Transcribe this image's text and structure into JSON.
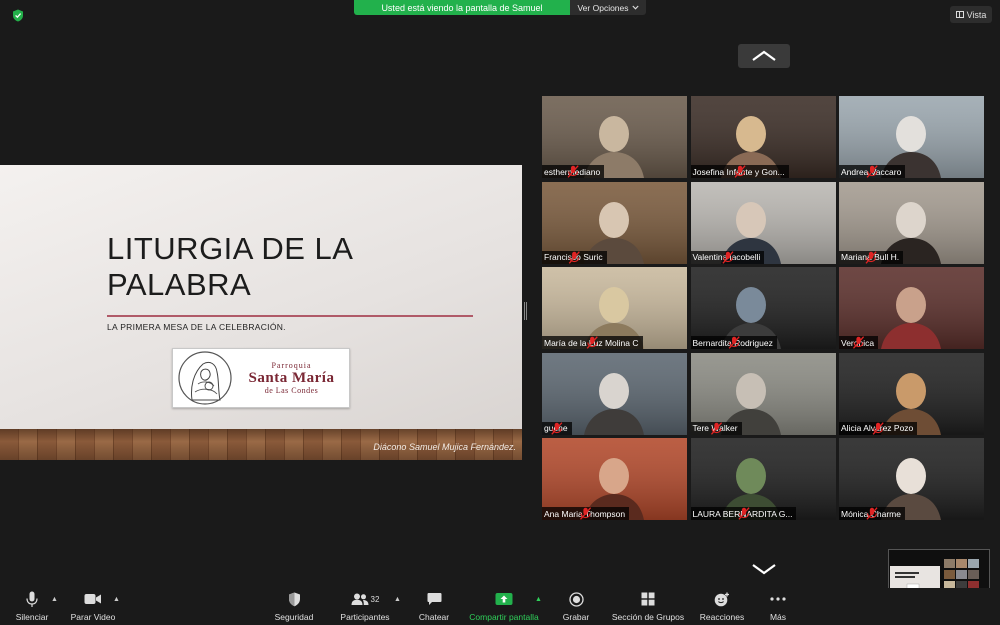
{
  "share_bar": {
    "viewing_text": "Usted está viendo la pantalla de Samuel",
    "options_label": "Ver Opciones"
  },
  "view_button": {
    "label": "Vista"
  },
  "slide": {
    "title": "LITURGIA DE LA PALABRA",
    "subtitle": "LA PRIMERA MESA DE LA CELEBRACIÓN.",
    "logo_line1": "Parroquia",
    "logo_line2": "Santa María",
    "logo_line3": "de Las Condes",
    "credit": "Diácono Samuel Mujica Fernández."
  },
  "participants": [
    {
      "name": "esthermediano",
      "colors": [
        "#6a5b4c",
        "#c9b79f",
        "#8d7b68"
      ]
    },
    {
      "name": "Josefina Infante y Gon...",
      "colors": [
        "#3a2c25",
        "#d7b98f",
        "#8a6a55"
      ]
    },
    {
      "name": "Andrea Vaccaro",
      "colors": [
        "#9aa6ae",
        "#e3e0dc",
        "#3b3331"
      ]
    },
    {
      "name": "Francisco Suric",
      "colors": [
        "#7a5a3c",
        "#d8c6b2",
        "#5b4a3d"
      ]
    },
    {
      "name": "Valentina iacobelli",
      "colors": [
        "#b9b6b1",
        "#d7c7b8",
        "#2e3540"
      ]
    },
    {
      "name": "Mariana Bull H.",
      "colors": [
        "#a39a8f",
        "#ddd5cc",
        "#2a2421"
      ]
    },
    {
      "name": "María de la Luz Molina C",
      "colors": [
        "#c8b89c",
        "#d9c8a1",
        "#8c7a5d"
      ]
    },
    {
      "name": "Bernardita Rodriguez",
      "colors": [
        "#1f1f1f",
        "#7a8a9a",
        "#3c3c3c"
      ]
    },
    {
      "name": "Veronica",
      "colors": [
        "#5a2e2a",
        "#c9a18b",
        "#8d2f2f"
      ]
    },
    {
      "name": "guene",
      "colors": [
        "#5b6670",
        "#d9d4cf",
        "#3f3c3a"
      ]
    },
    {
      "name": "Tere Walker",
      "colors": [
        "#8a8a82",
        "#c7bfb5",
        "#41403c"
      ]
    },
    {
      "name": "Alicia Alvarez Pozo",
      "colors": [
        "#1f1f1f",
        "#c99a6a",
        "#6e4d35"
      ]
    },
    {
      "name": "Ana Maria Thompson",
      "colors": [
        "#b2482a",
        "#d8a68a",
        "#5a2a1e"
      ]
    },
    {
      "name": "LAURA BERNARDITA G...",
      "colors": [
        "#1f1f1f",
        "#6f8a5a",
        "#3d4d33"
      ]
    },
    {
      "name": "Mónica Charme",
      "colors": [
        "#1f1f1f",
        "#e8e0d8",
        "#5a4a40"
      ]
    }
  ],
  "toolbar": {
    "mute": "Silenciar",
    "stop_video": "Parar Video",
    "security": "Seguridad",
    "participants": "Participantes",
    "participants_count": "32",
    "chat": "Chatear",
    "share_screen": "Compartir pantalla",
    "record": "Grabar",
    "breakout": "Sección de Grupos",
    "reactions": "Reacciones",
    "more": "Más"
  },
  "colors": {
    "share_green": "#22b14c",
    "background": "#1a1a1a",
    "muted_red": "#e02424",
    "slide_accent": "#7a2734"
  }
}
